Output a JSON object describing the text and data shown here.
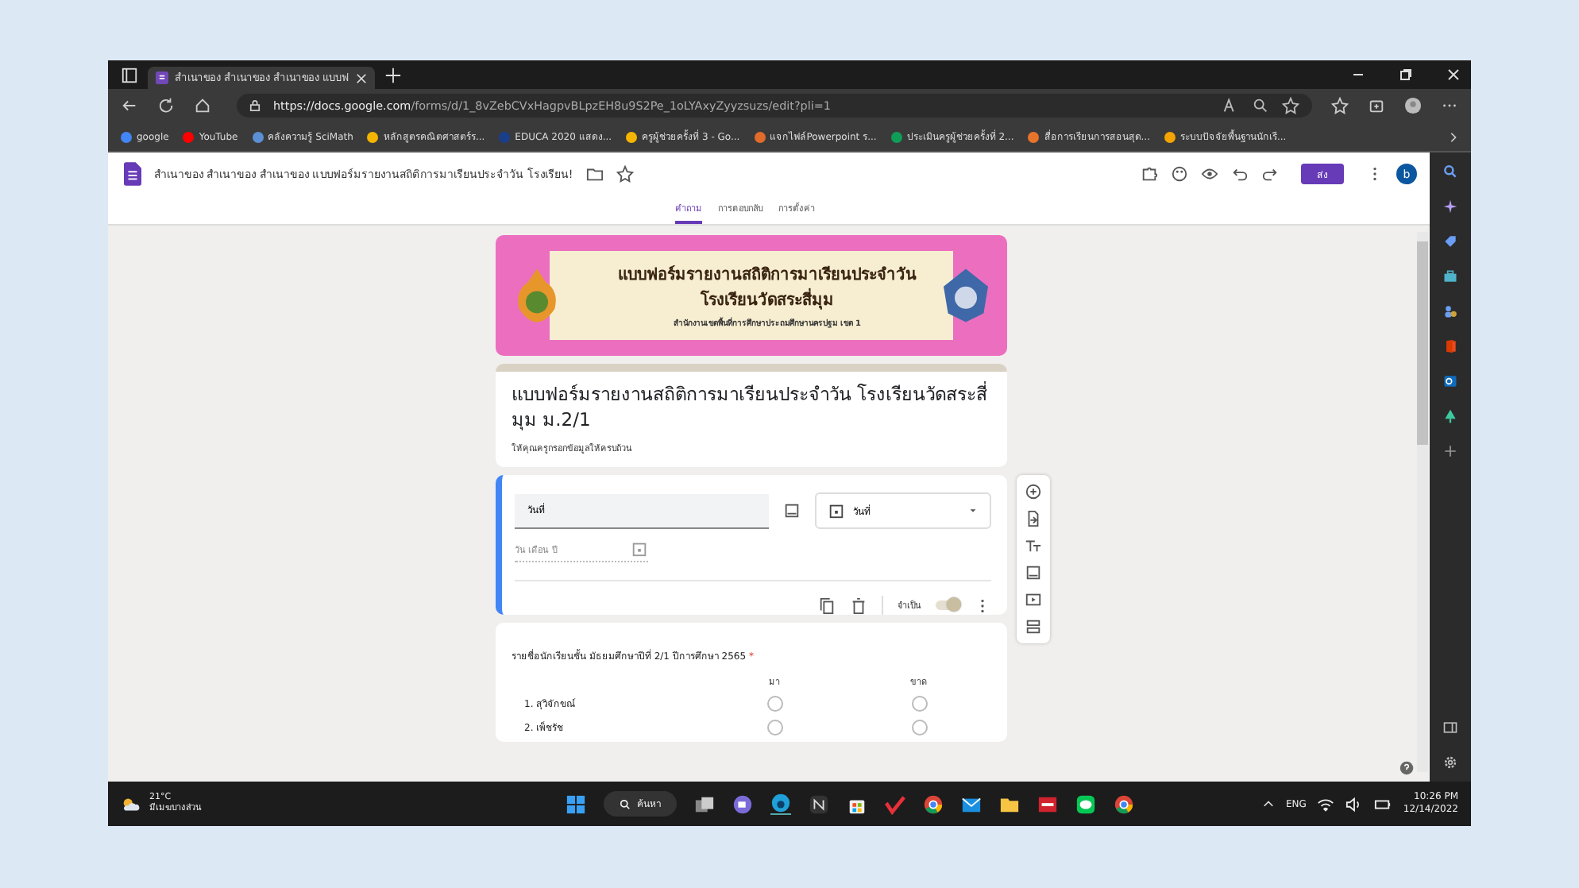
{
  "browser": {
    "tab": {
      "title": "สำเนาของ สำเนาของ สำเนาของ แบบฟ",
      "selected": true
    },
    "url_host": "https://docs.google.com",
    "url_path": "/forms/d/1_8vZebCVxHagpvBLpzEH8u9S2Pe_1oLYAxyZyyzsuzs/edit?pli=1",
    "bookmarks": [
      {
        "label": "google",
        "color": "#4285f4"
      },
      {
        "label": "YouTube",
        "color": "#ff0000"
      },
      {
        "label": "คลังความรู้ SciMath",
        "color": "#5b8fd6"
      },
      {
        "label": "หลักสูตรคณิตศาสตร์ร...",
        "color": "#f4b400"
      },
      {
        "label": "EDUCA 2020 แสดง...",
        "color": "#1a3f8a"
      },
      {
        "label": "ครูผู้ช่วยครั้งที่ 3 - Go...",
        "color": "#f4b400"
      },
      {
        "label": "แจกไฟล์Powerpoint ร...",
        "color": "#e06b2a"
      },
      {
        "label": "ประเมินครูผู้ช่วยครั้งที่ 2...",
        "color": "#0f9d58"
      },
      {
        "label": "สื่อการเรียนการสอนสุด...",
        "color": "#e8742c"
      },
      {
        "label": "ระบบปัจจัยพื้นฐานนักเรี...",
        "color": "#f4a300"
      }
    ]
  },
  "forms": {
    "doc_title": "สำเนาของ สำเนาของ สำเนาของ แบบฟอร์มรายงานสถิติการมาเรียนประจำวัน โรงเรียน!",
    "send_label": "ส่ง",
    "avatar": "b",
    "tabs": [
      {
        "label": "คำถาม",
        "selected": true
      },
      {
        "label": "การตอบกลับ",
        "selected": false
      },
      {
        "label": "การตั้งค่า",
        "selected": false
      }
    ],
    "banner": {
      "line_1": "แบบฟอร์มรายงานสถิติการมาเรียนประจำวัน",
      "line_2": "โรงเรียนวัดสระสี่มุม",
      "line_3": "สำนักงานเขตพื้นที่การศึกษาประถมศึกษานครปฐม เขต 1"
    },
    "title": "แบบฟอร์มรายงานสถิติการมาเรียนประจำวัน โรงเรียนวัดสระสี่มุม ม.2/1",
    "description": "ให้คุณครูกรอกข้อมูลให้ครบถ้วน",
    "question": {
      "title": "วันที่",
      "type": "วันที่",
      "placeholder": "วัน เดือน ปี",
      "required_label": "จำเป็น",
      "required": true
    },
    "grid": {
      "title": "รายชื่อนักเรียนชั้น มัธยมศึกษาปีที่  2/1  ปีการศึกษา 2565",
      "required_mark": "*",
      "columns": [
        "มา",
        "ขาด"
      ],
      "rows": [
        {
          "label": "1. สุวิจักขณ์",
          "choices": [
            false,
            false
          ]
        },
        {
          "label": "2. เพ็ชรัช",
          "choices": [
            false,
            false
          ]
        }
      ]
    }
  },
  "taskbar": {
    "temperature": "21°C",
    "weather": "มีเมฆบางส่วน",
    "search": "ค้นหา",
    "language": "ENG",
    "time": "10:26 PM",
    "date": "12/14/2022"
  }
}
